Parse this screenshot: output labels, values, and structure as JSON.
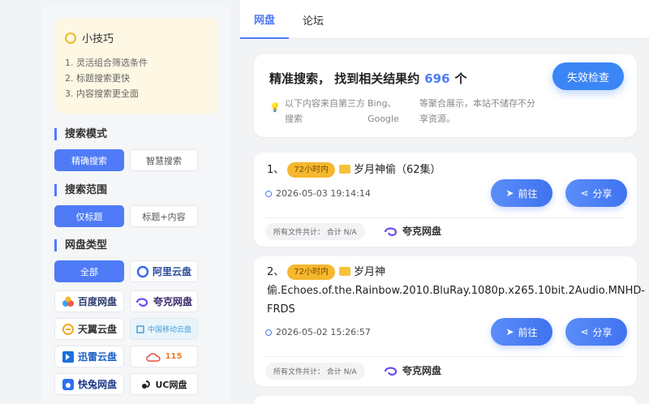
{
  "sidebar": {
    "tips": {
      "title": "小技巧",
      "items": [
        "1. 灵活组合筛选条件",
        "2. 标题搜索更快",
        "3. 内容搜索更全面"
      ]
    },
    "search_mode": {
      "title": "搜索模式",
      "options": [
        "精确搜索",
        "智慧搜索"
      ],
      "selected": 0
    },
    "search_scope": {
      "title": "搜索范围",
      "options": [
        "仅标题",
        "标题+内容"
      ],
      "selected": 0
    },
    "drive_type": {
      "title": "网盘类型",
      "options": [
        "全部",
        "阿里云盘",
        "百度网盘",
        "夸克网盘",
        "天翼云盘",
        "中国移动云盘",
        "迅雷云盘",
        "115",
        "快兔网盘",
        "UC网盘"
      ],
      "selected": 0
    }
  },
  "tabs": [
    "网盘",
    "论坛"
  ],
  "summary": {
    "prefix": "精准搜索， 找到相关结果约",
    "count": "696",
    "suffix": "个",
    "note_1": "以下内容来自第三方搜索",
    "note_2": "Bing、Google",
    "note_3": "等聚合展示，本站不储存不分享资源。",
    "check_button": "失效检查"
  },
  "results": [
    {
      "index": "1、",
      "badge": "72小时内",
      "title": "岁月神偷（62集）",
      "time": "2026-05-03 19:14:14",
      "size": "所有文件共计： 合计 N/A",
      "provider": "夸克网盘",
      "go_label": "前往",
      "share_label": "分享"
    },
    {
      "index": "2、",
      "badge": "72小时内",
      "title_line1": "岁月神",
      "title_line2": "偷.Echoes.of.the.Rainbow.2010.BluRay.1080p.x265.10bit.2Audio.MNHD-",
      "title_line3": "FRDS",
      "time": "2026-05-02 15:26:57",
      "size": "所有文件共计： 合计 N/A",
      "provider": "夸克网盘",
      "go_label": "前往",
      "share_label": "分享"
    }
  ],
  "colors": {
    "accent": "#4f7bf7",
    "badge": "#f5b82e",
    "check_button": "#3b86f5"
  }
}
